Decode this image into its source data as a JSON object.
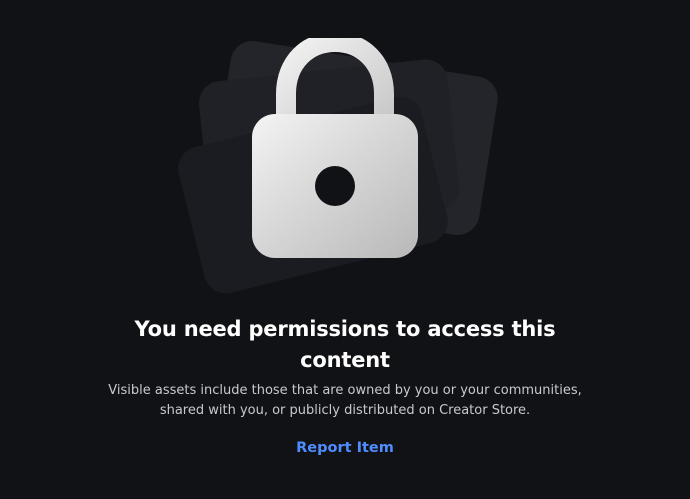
{
  "empty_state": {
    "illustration_icon": "lock-icon",
    "title": "You need permissions to access this content",
    "description": "Visible assets include those that are owned by you or your communities, shared with you, or publicly distributed on Creator Store.",
    "report_link": "Report Item"
  },
  "colors": {
    "background": "#111216",
    "card_back": "#23252b",
    "card_mid": "#1f2126",
    "card_front": "#1b1c21",
    "title": "#ffffff",
    "body_text": "#c7c9ce",
    "link": "#4f8cff"
  }
}
